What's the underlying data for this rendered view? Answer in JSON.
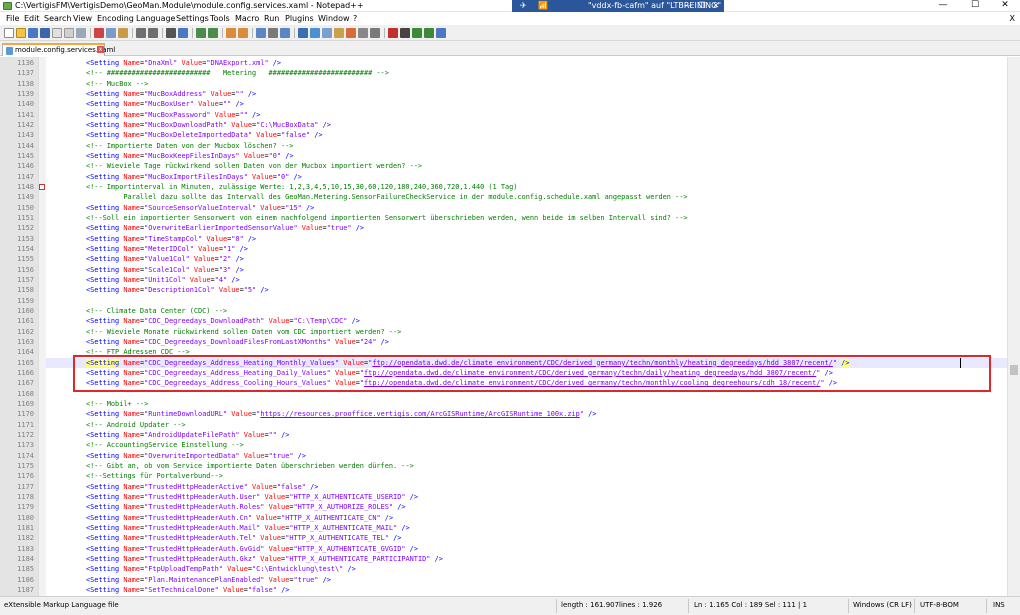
{
  "window": {
    "title": "C:\\VertigisFM\\VertigisDemo\\GeoMan.Module\\module.config.services.xaml - Notepad++",
    "min": "—",
    "max": "☐",
    "close": "✕"
  },
  "remote": {
    "pin": "✈",
    "signal": "📶",
    "title": "\"vddx-fb-cafm\" auf \"LTBREINING\"",
    "min": "—",
    "restore": "❐",
    "close": "✕"
  },
  "menu": [
    "File",
    "Edit",
    "Search",
    "View",
    "Encoding",
    "Language",
    "Settings",
    "Tools",
    "Macro",
    "Run",
    "Plugins",
    "Window",
    "?"
  ],
  "menu_close": "X",
  "tab": {
    "label": "module.config.services.xaml",
    "close": "x"
  },
  "lines": [
    {
      "n": "1136",
      "h": "<span class=\"tag\">&lt;Setting</span> <span class=\"attr\">Name</span>=<span class=\"val\">\"DnaXml\"</span> <span class=\"attr\">Value</span>=<span class=\"val\">\"DNAExport.xml\"</span> <span class=\"tag\">/&gt;</span>"
    },
    {
      "n": "1137",
      "h": "<span class=\"cmt\">&lt;!-- #########################   Metering   ######################### --&gt;</span>"
    },
    {
      "n": "1138",
      "h": "<span class=\"cmt\">&lt;!-- MucBox --&gt;</span>"
    },
    {
      "n": "1139",
      "h": "<span class=\"tag\">&lt;Setting</span> <span class=\"attr\">Name</span>=<span class=\"val\">\"MucBoxAddress\"</span> <span class=\"attr\">Value</span>=<span class=\"val\">\"\"</span> <span class=\"tag\">/&gt;</span>"
    },
    {
      "n": "1140",
      "h": "<span class=\"tag\">&lt;Setting</span> <span class=\"attr\">Name</span>=<span class=\"val\">\"MucBoxUser\"</span> <span class=\"attr\">Value</span>=<span class=\"val\">\"\"</span> <span class=\"tag\">/&gt;</span>"
    },
    {
      "n": "1141",
      "h": "<span class=\"tag\">&lt;Setting</span> <span class=\"attr\">Name</span>=<span class=\"val\">\"MucBoxPassword\"</span> <span class=\"attr\">Value</span>=<span class=\"val\">\"\"</span> <span class=\"tag\">/&gt;</span>"
    },
    {
      "n": "1142",
      "h": "<span class=\"tag\">&lt;Setting</span> <span class=\"attr\">Name</span>=<span class=\"val\">\"MucBoxDownloadPath\"</span> <span class=\"attr\">Value</span>=<span class=\"val\">\"C:\\MucBoxData\"</span> <span class=\"tag\">/&gt;</span>"
    },
    {
      "n": "1143",
      "h": "<span class=\"tag\">&lt;Setting</span> <span class=\"attr\">Name</span>=<span class=\"val\">\"MucBoxDeleteImportedData\"</span> <span class=\"attr\">Value</span>=<span class=\"val\">\"false\"</span> <span class=\"tag\">/&gt;</span>"
    },
    {
      "n": "1144",
      "h": "<span class=\"cmt\">&lt;!-- Importierte Daten von der Mucbox löschen? --&gt;</span>"
    },
    {
      "n": "1145",
      "h": "<span class=\"tag\">&lt;Setting</span> <span class=\"attr\">Name</span>=<span class=\"val\">\"MucBoxKeepFilesInDays\"</span> <span class=\"attr\">Value</span>=<span class=\"val\">\"0\"</span> <span class=\"tag\">/&gt;</span>"
    },
    {
      "n": "1146",
      "h": "<span class=\"cmt\">&lt;!-- Wieviele Tage rückwirkend sollen Daten von der Mucbox importiert werden? --&gt;</span>"
    },
    {
      "n": "1147",
      "h": "<span class=\"tag\">&lt;Setting</span> <span class=\"attr\">Name</span>=<span class=\"val\">\"MucBoxImportFilesInDays\"</span> <span class=\"attr\">Value</span>=<span class=\"val\">\"0\"</span> <span class=\"tag\">/&gt;</span>"
    },
    {
      "n": "1148",
      "h": "<span class=\"cmt\">&lt;!-- Importinterval in Minuten, zulässige Werte: 1,2,3,4,5,10,15,30,60,120,180,240,360,720,1.440 (1 Tag)</span>"
    },
    {
      "n": "1149",
      "h": "<span class=\"cmt\">         Parallel dazu sollte das Intervall des GeoMan.Metering.SensorFailureCheckService in der module.config.schedule.xaml angepasst werden --&gt;</span>"
    },
    {
      "n": "1150",
      "h": "<span class=\"tag\">&lt;Setting</span> <span class=\"attr\">Name</span>=<span class=\"val\">\"SourceSensorValueInterval\"</span> <span class=\"attr\">Value</span>=<span class=\"val\">\"15\"</span> <span class=\"tag\">/&gt;</span>"
    },
    {
      "n": "1151",
      "h": "<span class=\"cmt\">&lt;!--Soll ein importierter Sensorwert von einem nachfolgend importierten Sensorwert überschrieben werden, wenn beide im selben Intervall sind? --&gt;</span>"
    },
    {
      "n": "1152",
      "h": "<span class=\"tag\">&lt;Setting</span> <span class=\"attr\">Name</span>=<span class=\"val\">\"OverwriteEarlierImportedSensorValue\"</span> <span class=\"attr\">Value</span>=<span class=\"val\">\"true\"</span> <span class=\"tag\">/&gt;</span>"
    },
    {
      "n": "1153",
      "h": "<span class=\"tag\">&lt;Setting</span> <span class=\"attr\">Name</span>=<span class=\"val\">\"TimeStampCol\"</span> <span class=\"attr\">Value</span>=<span class=\"val\">\"0\"</span> <span class=\"tag\">/&gt;</span>"
    },
    {
      "n": "1154",
      "h": "<span class=\"tag\">&lt;Setting</span> <span class=\"attr\">Name</span>=<span class=\"val\">\"MeterIDCol\"</span> <span class=\"attr\">Value</span>=<span class=\"val\">\"1\"</span> <span class=\"tag\">/&gt;</span>"
    },
    {
      "n": "1155",
      "h": "<span class=\"tag\">&lt;Setting</span> <span class=\"attr\">Name</span>=<span class=\"val\">\"Value1Col\"</span> <span class=\"attr\">Value</span>=<span class=\"val\">\"2\"</span> <span class=\"tag\">/&gt;</span>"
    },
    {
      "n": "1156",
      "h": "<span class=\"tag\">&lt;Setting</span> <span class=\"attr\">Name</span>=<span class=\"val\">\"Scale1Col\"</span> <span class=\"attr\">Value</span>=<span class=\"val\">\"3\"</span> <span class=\"tag\">/&gt;</span>"
    },
    {
      "n": "1157",
      "h": "<span class=\"tag\">&lt;Setting</span> <span class=\"attr\">Name</span>=<span class=\"val\">\"Unit1Col\"</span> <span class=\"attr\">Value</span>=<span class=\"val\">\"4\"</span> <span class=\"tag\">/&gt;</span>"
    },
    {
      "n": "1158",
      "h": "<span class=\"tag\">&lt;Setting</span> <span class=\"attr\">Name</span>=<span class=\"val\">\"Description1Col\"</span> <span class=\"attr\">Value</span>=<span class=\"val\">\"5\"</span> <span class=\"tag\">/&gt;</span>"
    },
    {
      "n": "1159",
      "h": ""
    },
    {
      "n": "1160",
      "h": "<span class=\"cmt\">&lt;!-- Climate Data Center (CDC) --&gt;</span>"
    },
    {
      "n": "1161",
      "h": "<span class=\"tag\">&lt;Setting</span> <span class=\"attr\">Name</span>=<span class=\"val\">\"CDC_Degreedays_DownloadPath\"</span> <span class=\"attr\">Value</span>=<span class=\"val\">\"C:\\Temp\\CDC\"</span> <span class=\"tag\">/&gt;</span>"
    },
    {
      "n": "1162",
      "h": "<span class=\"cmt\">&lt;!-- Wieviele Monate rückwirkend sollen Daten vom CDC importiert werden? --&gt;</span>"
    },
    {
      "n": "1163",
      "h": "<span class=\"tag\">&lt;Setting</span> <span class=\"attr\">Name</span>=<span class=\"val\">\"CDC_Degreedays_DownloadFilesFromLastXMonths\"</span> <span class=\"attr\">Value</span>=<span class=\"val\">\"24\"</span> <span class=\"tag\">/&gt;</span>"
    },
    {
      "n": "1164",
      "h": "<span class=\"cmt\">&lt;!-- FTP Adressen CDC --&gt;</span>"
    },
    {
      "n": "1165",
      "h": "<span class=\"tag hl\">&lt;Setting</span> <span class=\"attr\">Name</span>=<span class=\"val\">\"CDC_Degreedays_Address_Heating_Monthly_Values\"</span> <span class=\"attr\">Value</span>=<span class=\"val\">\"<span class=\"url\">ftp://opendata.dwd.de/climate_environment/CDC/derived_germany/techn/monthly/heating_degreedays/hdd_3807/recent/</span>\"</span> <span class=\"tag hl\">/&gt;</span>",
      "current": true
    },
    {
      "n": "1166",
      "h": "<span class=\"tag\">&lt;Setting</span> <span class=\"attr\">Name</span>=<span class=\"val\">\"CDC_Degreedays_Address_Heating_Daily_Values\"</span> <span class=\"attr\">Value</span>=<span class=\"val\">\"<span class=\"url\">ftp://opendata.dwd.de/climate_environment/CDC/derived_germany/techn/daily/heating_degreedays/hdd_3807/recent/</span>\"</span> <span class=\"tag\">/&gt;</span>"
    },
    {
      "n": "1167",
      "h": "<span class=\"tag\">&lt;Setting</span> <span class=\"attr\">Name</span>=<span class=\"val\">\"CDC_Degreedays_Address_Cooling_Hours_Values\"</span> <span class=\"attr\">Value</span>=<span class=\"val\">\"<span class=\"url\">ftp://opendata.dwd.de/climate_environment/CDC/derived_germany/techn/monthly/cooling_degreehours/cdh_18/recent/</span>\"</span> <span class=\"tag\">/&gt;</span>"
    },
    {
      "n": "1168",
      "h": ""
    },
    {
      "n": "1169",
      "h": "<span class=\"cmt\">&lt;!-- Mobil+ --&gt;</span>"
    },
    {
      "n": "1170",
      "h": "<span class=\"tag\">&lt;Setting</span> <span class=\"attr\">Name</span>=<span class=\"val\">\"RuntimeDownloadURL\"</span> <span class=\"attr\">Value</span>=<span class=\"val\">\"<span class=\"url\">https://resources.prooffice.vertigis.com/ArcGISRuntime/ArcGISRuntime_100x.zip</span>\"</span> <span class=\"tag\">/&gt;</span>"
    },
    {
      "n": "1171",
      "h": "<span class=\"cmt\">&lt;!-- Android Updater --&gt;</span>"
    },
    {
      "n": "1172",
      "h": "<span class=\"tag\">&lt;Setting</span> <span class=\"attr\">Name</span>=<span class=\"val\">\"AndroidUpdateFilePath\"</span> <span class=\"attr\">Value</span>=<span class=\"val\">\"\"</span> <span class=\"tag\">/&gt;</span>"
    },
    {
      "n": "1173",
      "h": "<span class=\"cmt\">&lt;!-- AccountingService Einstellung --&gt;</span>"
    },
    {
      "n": "1174",
      "h": "<span class=\"tag\">&lt;Setting</span> <span class=\"attr\">Name</span>=<span class=\"val\">\"OverwriteImportedData\"</span> <span class=\"attr\">Value</span>=<span class=\"val\">\"true\"</span> <span class=\"tag\">/&gt;</span>"
    },
    {
      "n": "1175",
      "h": "<span class=\"cmt\">&lt;!-- Gibt an, ob vom Service importierte Daten überschrieben werden dürfen. --&gt;</span>"
    },
    {
      "n": "1176",
      "h": "<span class=\"cmt\">&lt;!--Settings für Portalverbund--&gt;</span>"
    },
    {
      "n": "1177",
      "h": "<span class=\"tag\">&lt;Setting</span> <span class=\"attr\">Name</span>=<span class=\"val\">\"TrustedHttpHeaderActive\"</span> <span class=\"attr\">Value</span>=<span class=\"val\">\"false\"</span> <span class=\"tag\">/&gt;</span>"
    },
    {
      "n": "1178",
      "h": "<span class=\"tag\">&lt;Setting</span> <span class=\"attr\">Name</span>=<span class=\"val\">\"TrustedHttpHeaderAuth.User\"</span> <span class=\"attr\">Value</span>=<span class=\"val\">\"HTTP_X_AUTHENTICATE_USERID\"</span> <span class=\"tag\">/&gt;</span>"
    },
    {
      "n": "1179",
      "h": "<span class=\"tag\">&lt;Setting</span> <span class=\"attr\">Name</span>=<span class=\"val\">\"TrustedHttpHeaderAuth.Roles\"</span> <span class=\"attr\">Value</span>=<span class=\"val\">\"HTTP_X_AUTHORIZE_ROLES\"</span> <span class=\"tag\">/&gt;</span>"
    },
    {
      "n": "1180",
      "h": "<span class=\"tag\">&lt;Setting</span> <span class=\"attr\">Name</span>=<span class=\"val\">\"TrustedHttpHeaderAuth.Cn\"</span> <span class=\"attr\">Value</span>=<span class=\"val\">\"HTTP_X_AUTHENTICATE_CN\"</span> <span class=\"tag\">/&gt;</span>"
    },
    {
      "n": "1181",
      "h": "<span class=\"tag\">&lt;Setting</span> <span class=\"attr\">Name</span>=<span class=\"val\">\"TrustedHttpHeaderAuth.Mail\"</span> <span class=\"attr\">Value</span>=<span class=\"val\">\"HTTP_X_AUTHENTICATE_MAIL\"</span> <span class=\"tag\">/&gt;</span>"
    },
    {
      "n": "1182",
      "h": "<span class=\"tag\">&lt;Setting</span> <span class=\"attr\">Name</span>=<span class=\"val\">\"TrustedHttpHeaderAuth.Tel\"</span> <span class=\"attr\">Value</span>=<span class=\"val\">\"HTTP_X_AUTHENTICATE_TEL\"</span> <span class=\"tag\">/&gt;</span>"
    },
    {
      "n": "1183",
      "h": "<span class=\"tag\">&lt;Setting</span> <span class=\"attr\">Name</span>=<span class=\"val\">\"TrustedHttpHeaderAuth.GvGid\"</span> <span class=\"attr\">Value</span>=<span class=\"val\">\"HTTP_X_AUTHENTICATE_GVGID\"</span> <span class=\"tag\">/&gt;</span>"
    },
    {
      "n": "1184",
      "h": "<span class=\"tag\">&lt;Setting</span> <span class=\"attr\">Name</span>=<span class=\"val\">\"TrustedHttpHeaderAuth.Gkz\"</span> <span class=\"attr\">Value</span>=<span class=\"val\">\"HTTP_X_AUTHENTICATE_PARTICIPANTID\"</span> <span class=\"tag\">/&gt;</span>"
    },
    {
      "n": "1185",
      "h": "<span class=\"tag\">&lt;Setting</span> <span class=\"attr\">Name</span>=<span class=\"val\">\"FtpUploadTempPath\"</span> <span class=\"attr\">Value</span>=<span class=\"val\">\"C:\\Entwicklung\\test\\\"</span> <span class=\"tag\">/&gt;</span>"
    },
    {
      "n": "1186",
      "h": "<span class=\"tag\">&lt;Setting</span> <span class=\"attr\">Name</span>=<span class=\"val\">\"Plan.MaintenancePlanEnabled\"</span> <span class=\"attr\">Value</span>=<span class=\"val\">\"true\"</span> <span class=\"tag\">/&gt;</span>"
    },
    {
      "n": "1187",
      "h": "<span class=\"tag\">&lt;Setting</span> <span class=\"attr\">Name</span>=<span class=\"val\">\"SetTechnicalDone\"</span> <span class=\"attr\">Value</span>=<span class=\"val\">\"false\"</span> <span class=\"tag\">/&gt;</span>"
    }
  ],
  "status": {
    "filetype": "eXtensible Markup Language file",
    "length": "length : 161.907",
    "lines": "lines : 1.926",
    "pos": "Ln : 1.165    Col : 189    Sel : 111 | 1",
    "eol": "Windows (CR LF)",
    "encoding": "UTF-8-BOM",
    "mode": "INS"
  }
}
